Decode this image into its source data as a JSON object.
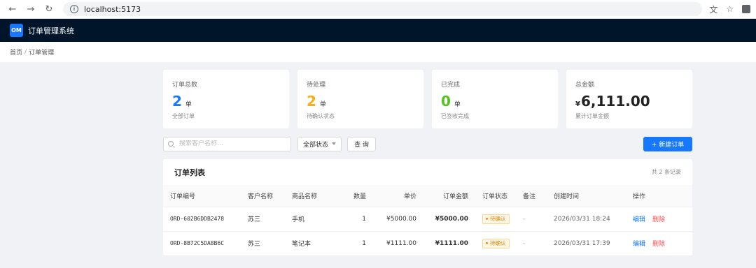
{
  "browser": {
    "url": "localhost:5173"
  },
  "header": {
    "logo": "OM",
    "title": "订单管理系统"
  },
  "breadcrumb": {
    "home": "首页",
    "separator": "/",
    "current": "订单管理"
  },
  "stats": [
    {
      "label": "订单总数",
      "value": "2",
      "unit": "单",
      "sub": "全部订单",
      "color": "#1677ff"
    },
    {
      "label": "待处理",
      "value": "2",
      "unit": "单",
      "sub": "待确认状态",
      "color": "#faad14"
    },
    {
      "label": "已完成",
      "value": "0",
      "unit": "单",
      "sub": "已签收完成",
      "color": "#52c41a"
    },
    {
      "label": "总金额",
      "prefix": "¥",
      "value": "6,111.00",
      "sub": "累计订单金额",
      "color": "#222222"
    }
  ],
  "toolbar": {
    "search_placeholder": "搜索客户名称...",
    "status_select": "全部状态",
    "query_label": "查 询",
    "new_label": "+ 新建订单"
  },
  "table": {
    "title": "订单列表",
    "count_text": "共 2 条记录",
    "headers": [
      "订单编号",
      "客户名称",
      "商品名称",
      "数量",
      "单价",
      "订单金额",
      "订单状态",
      "备注",
      "创建时间",
      "操作"
    ],
    "rows": [
      {
        "id": "ORD-602B6DDB2478",
        "customer": "苏三",
        "product": "手机",
        "qty": "1",
        "price": "¥5000.00",
        "amount": "¥5000.00",
        "status": "待确认",
        "note": "-",
        "time": "2026/03/31 18:24",
        "edit": "编辑",
        "delete": "删除"
      },
      {
        "id": "ORD-8B72C5DA8B6C",
        "customer": "苏三",
        "product": "笔记本",
        "qty": "1",
        "price": "¥1111.00",
        "amount": "¥1111.00",
        "status": "待确认",
        "note": "-",
        "time": "2026/03/31 17:39",
        "edit": "编辑",
        "delete": "删除"
      }
    ]
  }
}
